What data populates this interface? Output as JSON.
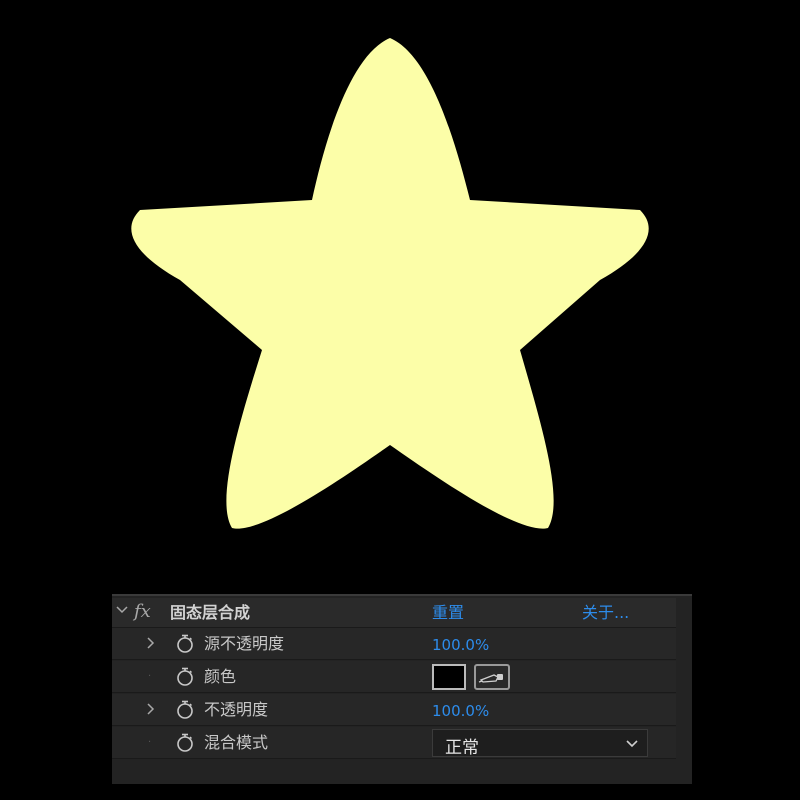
{
  "canvas": {
    "background": "#000000",
    "star_color": "#FCFEA8"
  },
  "effect": {
    "name": "固态层合成",
    "reset_label": "重置",
    "about_label": "关于...",
    "properties": [
      {
        "label": "源不透明度",
        "value": "100.0%"
      },
      {
        "label": "颜色",
        "value": "#000000"
      },
      {
        "label": "不透明度",
        "value": "100.0%"
      },
      {
        "label": "混合模式",
        "value": "正常"
      }
    ]
  },
  "colors": {
    "link_blue": "#2D8CEB",
    "panel_bg": "#232323"
  }
}
